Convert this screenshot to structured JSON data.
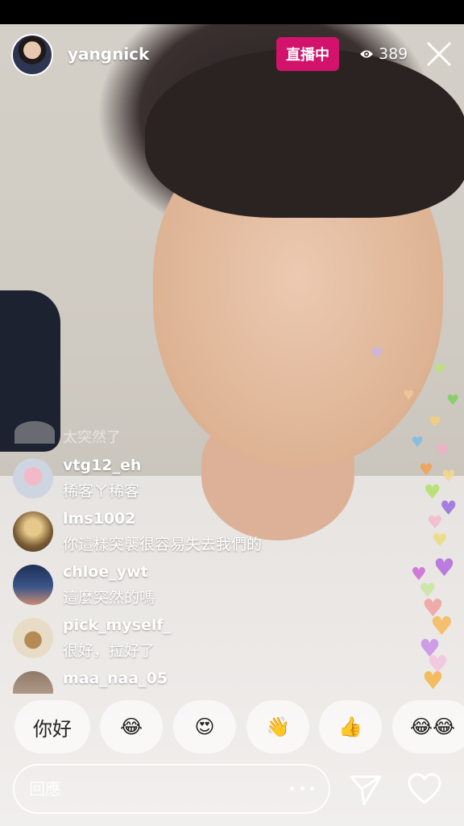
{
  "header": {
    "host_name": "yangnick",
    "live_label": "直播中",
    "viewer_count": "389",
    "icons": {
      "viewers": "eye-icon",
      "close": "close-icon"
    }
  },
  "comments": {
    "faded_message": "太突然了",
    "items": [
      {
        "user": "vtg12_eh",
        "message": "稀客ㄚ稀客"
      },
      {
        "user": "lms1002",
        "message": "你這樣突襲很容易失去我們的"
      },
      {
        "user": "chloe_ywt",
        "message": "這麼突然的嗎"
      },
      {
        "user": "pick_myself_",
        "message": "很好，拉好了"
      },
      {
        "user": "maa_naa_05",
        "message": ""
      }
    ]
  },
  "quick_replies": [
    "你好",
    "😂",
    "😍",
    "👋",
    "👍",
    "😂😂"
  ],
  "reply_bar": {
    "placeholder": "回應",
    "icons": {
      "more": "more-icon",
      "send": "send-icon",
      "like": "heart-icon"
    }
  },
  "colors": {
    "live_badge": "#d3136b",
    "text": "#ffffff"
  }
}
